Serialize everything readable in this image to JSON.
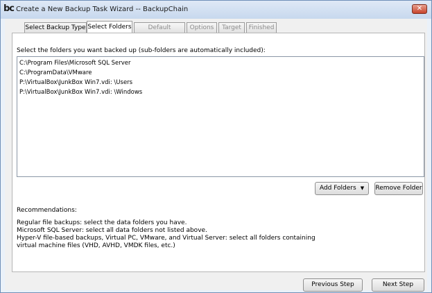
{
  "window": {
    "logo": "bc",
    "title": "Create a New Backup Task Wizard -- BackupChain",
    "close_label": "✕"
  },
  "tabs": [
    {
      "label": "Select Backup Type",
      "state": "normal"
    },
    {
      "label": "Select Folders",
      "state": "active"
    },
    {
      "label": "Default Settings",
      "state": "disabled"
    },
    {
      "label": "Options",
      "state": "disabled"
    },
    {
      "label": "Target",
      "state": "disabled"
    },
    {
      "label": "Finished",
      "state": "disabled"
    }
  ],
  "main": {
    "instruction": "Select the folders you want backed up (sub-folders are automatically included):",
    "folders": [
      "C:\\Program Files\\Microsoft SQL Server",
      "C:\\ProgramData\\VMware",
      "P:\\VirtualBox\\JunkBox Win7.vdi: \\Users",
      "P:\\VirtualBox\\JunkBox Win7.vdi: \\Windows"
    ],
    "add_folders_label": "Add Folders",
    "remove_folder_label": "Remove Folder",
    "recommendations_title": "Recommendations:",
    "recommendations": [
      "Regular file backups: select the data folders you have.",
      "Microsoft SQL Server: select all data folders not listed above.",
      "Hyper-V file-based backups, Virtual PC, VMware, and Virtual Server: select all folders containing",
      "virtual machine files (VHD, AVHD, VMDK files, etc.)"
    ]
  },
  "footer": {
    "previous_label": "Previous Step",
    "next_label": "Next Step"
  }
}
